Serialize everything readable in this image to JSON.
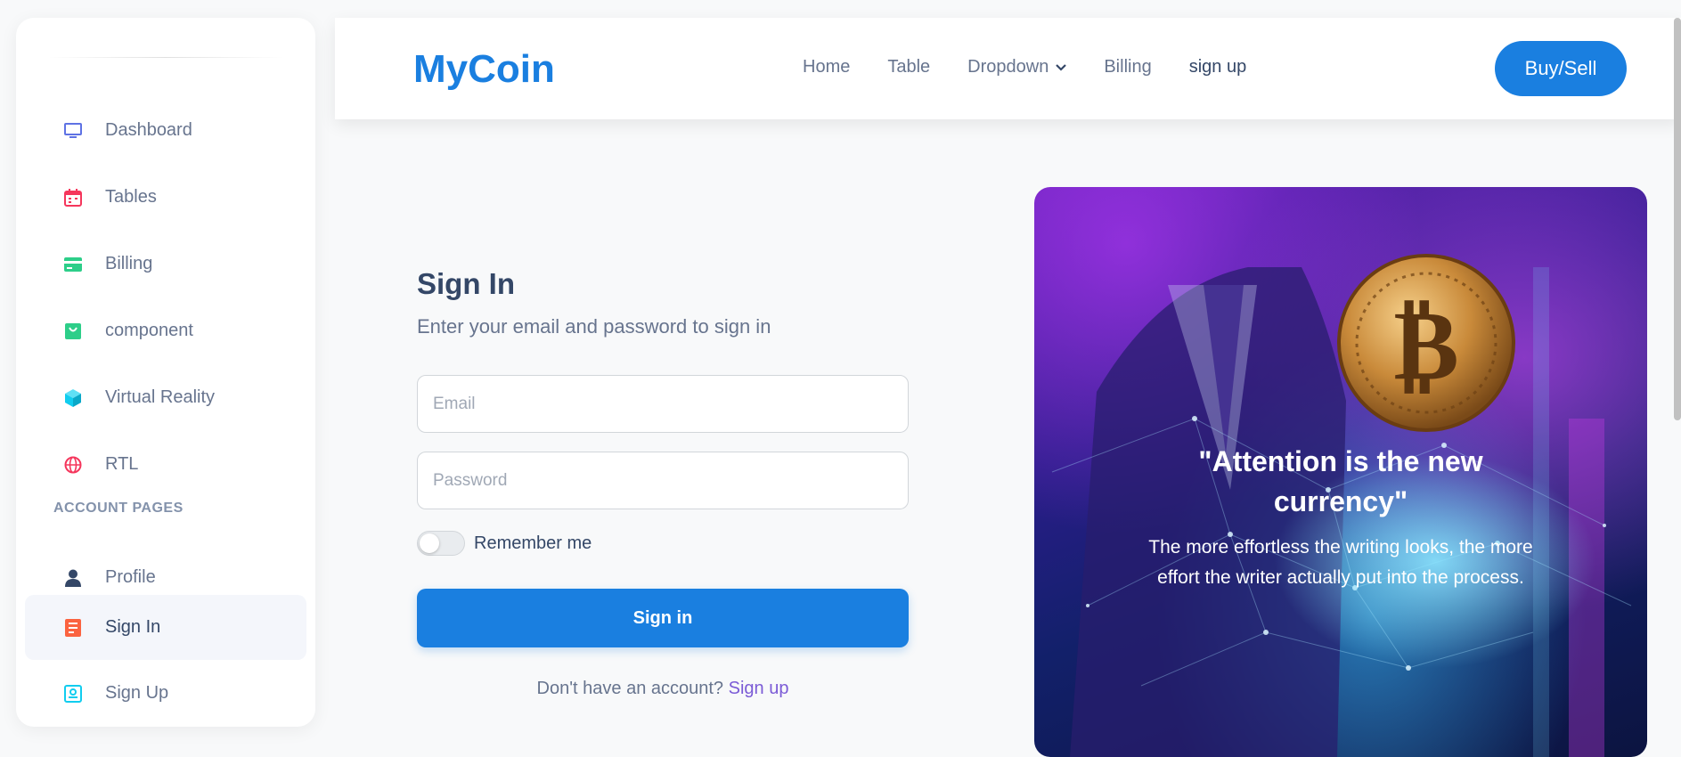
{
  "sidebar": {
    "items": [
      {
        "label": "Dashboard",
        "icon": "monitor-icon",
        "color": "#5e72e4"
      },
      {
        "label": "Tables",
        "icon": "calendar-icon",
        "color": "#f5365c"
      },
      {
        "label": "Billing",
        "icon": "credit-card-icon",
        "color": "#2dce89"
      },
      {
        "label": "component",
        "icon": "shopping-bag-icon",
        "color": "#2dce89"
      },
      {
        "label": "Virtual Reality",
        "icon": "cube-icon",
        "color": "#11cdef"
      },
      {
        "label": "RTL",
        "icon": "globe-icon",
        "color": "#f5365c"
      }
    ],
    "section_title": "ACCOUNT PAGES",
    "account_items": [
      {
        "label": "Profile",
        "icon": "user-icon",
        "color": "#344767"
      },
      {
        "label": "Sign In",
        "icon": "document-icon",
        "color": "#fb6340",
        "active": true
      },
      {
        "label": "Sign Up",
        "icon": "id-card-icon",
        "color": "#11cdef"
      }
    ]
  },
  "navbar": {
    "brand": "MyCoin",
    "links": [
      "Home",
      "Table",
      "Dropdown",
      "Billing",
      "sign up"
    ],
    "cta": "Buy/Sell"
  },
  "signin": {
    "title": "Sign In",
    "subtitle": "Enter your email and password to sign in",
    "email_placeholder": "Email",
    "password_placeholder": "Password",
    "remember": "Remember me",
    "remember_checked": false,
    "button": "Sign in",
    "no_account": "Don't have an account?",
    "signup_link": "Sign up"
  },
  "hero": {
    "quote": "\"Attention is the new currency\"",
    "description": "The more effortless the writing looks, the more effort the writer actually put into the process."
  },
  "colors": {
    "primary": "#1a7fe0",
    "link": "#7b5bd6"
  }
}
